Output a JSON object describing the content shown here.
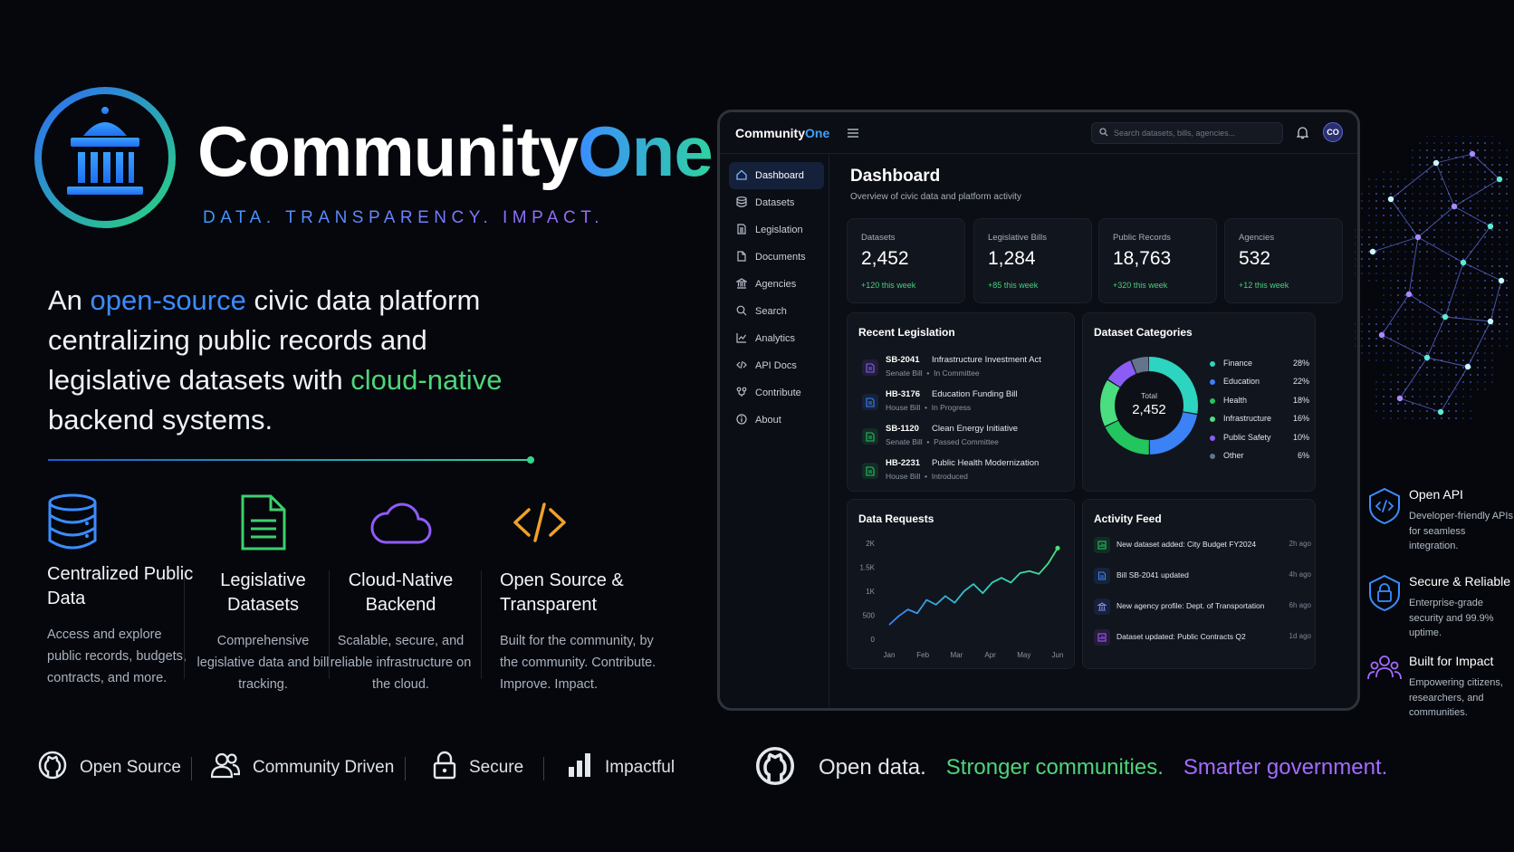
{
  "brand": {
    "name_part1": "Community",
    "name_part2": "One",
    "tagline": "DATA. TRANSPARENCY. IMPACT."
  },
  "headline": {
    "part1": "An ",
    "highlight1": "open-source",
    "part2": " civic data platform centralizing public records and legislative datasets with ",
    "highlight2": "cloud-native",
    "part3": " backend systems."
  },
  "features": [
    {
      "icon": "database-icon",
      "title": "Centralized Public Data",
      "description": "Access and explore public records, budgets, contracts, and more."
    },
    {
      "icon": "document-icon",
      "title": "Legislative Datasets",
      "description": "Comprehensive legislative data and bill tracking."
    },
    {
      "icon": "cloud-icon",
      "title": "Cloud-Native Backend",
      "description": "Scalable, secure, and reliable infrastructure on the cloud."
    },
    {
      "icon": "code-icon",
      "title": "Open Source & Transparent",
      "description": "Built for the community, by the community. Contribute. Improve. Impact."
    }
  ],
  "badges": [
    {
      "icon": "github-icon",
      "label": "Open Source"
    },
    {
      "icon": "users-icon",
      "label": "Community Driven"
    },
    {
      "icon": "lock-icon",
      "label": "Secure"
    },
    {
      "icon": "bar-chart-icon",
      "label": "Impactful"
    }
  ],
  "slogan": {
    "part1": "Open data.",
    "part2": "Stronger communities.",
    "part3": "Smarter government."
  },
  "dashboard": {
    "logo_part1": "Community",
    "logo_part2": "One",
    "search_placeholder": "Search datasets, bills, agencies...",
    "avatar_initials": "CO",
    "title": "Dashboard",
    "subtitle": "Overview of civic data and platform activity",
    "nav": [
      {
        "label": "Dashboard",
        "icon": "home-icon",
        "active": true
      },
      {
        "label": "Datasets",
        "icon": "database-icon"
      },
      {
        "label": "Legislation",
        "icon": "document-icon"
      },
      {
        "label": "Documents",
        "icon": "file-icon"
      },
      {
        "label": "Agencies",
        "icon": "building-icon"
      },
      {
        "label": "Search",
        "icon": "search-icon"
      },
      {
        "label": "Analytics",
        "icon": "analytics-icon"
      },
      {
        "label": "API Docs",
        "icon": "code-icon"
      },
      {
        "label": "Contribute",
        "icon": "contribute-icon"
      },
      {
        "label": "About",
        "icon": "info-icon"
      }
    ],
    "stats": [
      {
        "label": "Datasets",
        "value": "2,452",
        "change": "+120 this week"
      },
      {
        "label": "Legislative Bills",
        "value": "1,284",
        "change": "+85 this week"
      },
      {
        "label": "Public Records",
        "value": "18,763",
        "change": "+320 this week"
      },
      {
        "label": "Agencies",
        "value": "532",
        "change": "+12 this week"
      }
    ],
    "recent_legislation": {
      "title": "Recent Legislation",
      "items": [
        {
          "id": "SB-2041",
          "name": "Infrastructure Investment Act",
          "type": "Senate Bill",
          "status": "In Committee",
          "color": "#8b5cf6"
        },
        {
          "id": "HB-3176",
          "name": "Education Funding Bill",
          "type": "House Bill",
          "status": "In Progress",
          "color": "#3b82f6"
        },
        {
          "id": "SB-1120",
          "name": "Clean Energy Initiative",
          "type": "Senate Bill",
          "status": "Passed Committee",
          "color": "#22c55e"
        },
        {
          "id": "HB-2231",
          "name": "Public Health Modernization",
          "type": "House Bill",
          "status": "Introduced",
          "color": "#22c55e"
        }
      ]
    },
    "dataset_categories": {
      "title": "Dataset Categories",
      "total_label": "Total",
      "total_value": "2,452",
      "items": [
        {
          "name": "Finance",
          "pct": "28%",
          "value": 28,
          "color": "#2dd4bf"
        },
        {
          "name": "Education",
          "pct": "22%",
          "value": 22,
          "color": "#3b82f6"
        },
        {
          "name": "Health",
          "pct": "18%",
          "value": 18,
          "color": "#22c55e"
        },
        {
          "name": "Infrastructure",
          "pct": "16%",
          "value": 16,
          "color": "#4ade80"
        },
        {
          "name": "Public Safety",
          "pct": "10%",
          "value": 10,
          "color": "#8b5cf6"
        },
        {
          "name": "Other",
          "pct": "6%",
          "value": 6,
          "color": "#64748b"
        }
      ]
    },
    "data_requests": {
      "title": "Data Requests",
      "y_ticks": [
        "2K",
        "1.5K",
        "1K",
        "500",
        "0"
      ],
      "x_ticks": [
        "Jan",
        "Feb",
        "Mar",
        "Apr",
        "May",
        "Jun"
      ],
      "values": [
        300,
        480,
        620,
        540,
        820,
        720,
        900,
        760,
        1000,
        1150,
        960,
        1180,
        1280,
        1180,
        1380,
        1420,
        1360,
        1580,
        1900
      ]
    },
    "activity_feed": {
      "title": "Activity Feed",
      "items": [
        {
          "text": "New dataset added: City Budget FY2024",
          "time": "2h ago",
          "icon": "dataset-icon",
          "color": "#22c55e"
        },
        {
          "text": "Bill SB-2041 updated",
          "time": "4h ago",
          "icon": "document-icon",
          "color": "#3b82f6"
        },
        {
          "text": "New agency profile: Dept. of Transportation",
          "time": "6h ago",
          "icon": "building-icon",
          "color": "#6366f1"
        },
        {
          "text": "Dataset updated: Public Contracts Q2",
          "time": "1d ago",
          "icon": "dataset-icon",
          "color": "#a855f7"
        }
      ]
    }
  },
  "side_features": [
    {
      "icon": "api-shield-icon",
      "title": "Open API",
      "description": "Developer-friendly APIs for seamless integration."
    },
    {
      "icon": "lock-shield-icon",
      "title": "Secure & Reliable",
      "description": "Enterprise-grade security and 99.9% uptime."
    },
    {
      "icon": "people-icon",
      "title": "Built for Impact",
      "description": "Empowering citizens, researchers, and communities."
    }
  ],
  "colors": {
    "background": "#05070c",
    "accent_blue": "#3d8bff",
    "accent_green": "#4fd47a",
    "accent_purple": "#a46bff"
  }
}
